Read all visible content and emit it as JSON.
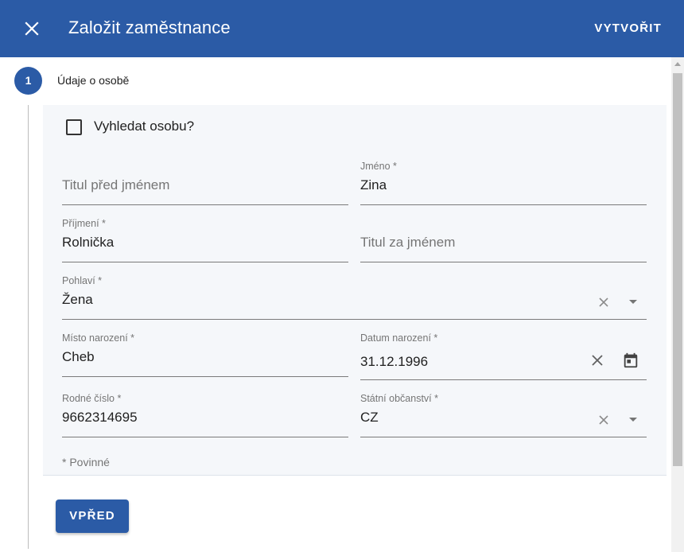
{
  "header": {
    "title": "Založit zaměstnance",
    "create_label": "VYTVOŘIT",
    "close_icon": "close-icon",
    "background": "#2b5ba6"
  },
  "stepper": {
    "step_number": "1",
    "step_label": "Údaje o osobě"
  },
  "form": {
    "search_person": {
      "label": "Vyhledat osobu?",
      "checked": false
    },
    "title_before": {
      "placeholder": "Titul před jménem",
      "value": ""
    },
    "first_name": {
      "label": "Jméno *",
      "value": "Zina"
    },
    "last_name": {
      "label": "Příjmení *",
      "value": "Rolnička"
    },
    "title_after": {
      "placeholder": "Titul za jménem",
      "value": ""
    },
    "gender": {
      "label": "Pohlaví *",
      "value": "Žena"
    },
    "birth_place": {
      "label": "Místo narození *",
      "value": "Cheb"
    },
    "birth_date": {
      "label": "Datum narození *",
      "value": "31.12.1996"
    },
    "personal_id": {
      "label": "Rodné číslo *",
      "value": "9662314695"
    },
    "citizenship": {
      "label": "Státní občanství *",
      "value": "CZ"
    },
    "required_note": "* Povinné"
  },
  "actions": {
    "next_label": "VPŘED"
  }
}
